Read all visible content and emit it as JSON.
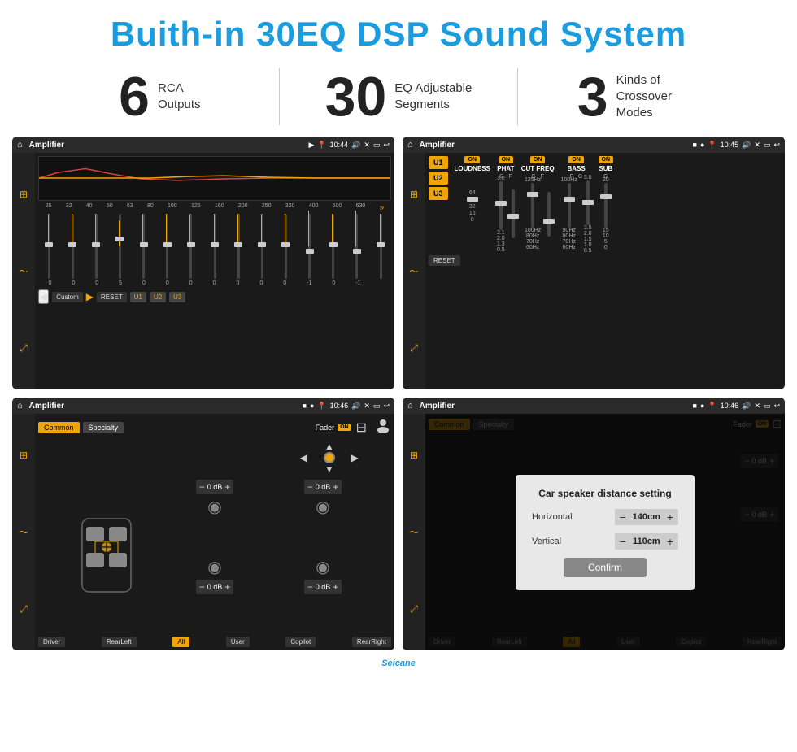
{
  "header": {
    "title": "Buith-in 30EQ DSP Sound System"
  },
  "stats": [
    {
      "number": "6",
      "desc": "RCA\nOutputs"
    },
    {
      "number": "30",
      "desc": "EQ Adjustable\nSegments"
    },
    {
      "number": "3",
      "desc": "Kinds of\nCrossover Modes"
    }
  ],
  "screens": {
    "eq": {
      "app_title": "Amplifier",
      "time": "10:44",
      "freq_labels": [
        "25",
        "32",
        "40",
        "50",
        "63",
        "80",
        "100",
        "125",
        "160",
        "200",
        "250",
        "320",
        "400",
        "500",
        "630"
      ],
      "values": [
        "0",
        "0",
        "0",
        "5",
        "0",
        "0",
        "0",
        "0",
        "0",
        "0",
        "0",
        "-1",
        "0",
        "-1"
      ],
      "controls": [
        "Custom",
        "RESET",
        "U1",
        "U2",
        "U3"
      ]
    },
    "amp": {
      "app_title": "Amplifier",
      "time": "10:45",
      "u_buttons": [
        "U1",
        "U2",
        "U3"
      ],
      "controls": [
        {
          "on": true,
          "label": "LOUDNESS",
          "sublabel": ""
        },
        {
          "on": true,
          "label": "PHAT",
          "sublabel": "G F"
        },
        {
          "on": true,
          "label": "CUT FREQ",
          "sublabel": "G F"
        },
        {
          "on": true,
          "label": "BASS",
          "sublabel": "F G"
        },
        {
          "on": true,
          "label": "SUB",
          "sublabel": "G"
        }
      ],
      "reset": "RESET"
    },
    "common": {
      "app_title": "Amplifier",
      "time": "10:46",
      "tabs": [
        "Common",
        "Specialty"
      ],
      "fader": "Fader",
      "fader_on": "ON",
      "speakers": {
        "tl_db": "0 dB",
        "tr_db": "0 dB",
        "bl_db": "0 dB",
        "br_db": "0 dB"
      },
      "buttons": [
        "Driver",
        "RearLeft",
        "All",
        "User",
        "Copilot",
        "RearRight"
      ]
    },
    "dialog": {
      "app_title": "Amplifier",
      "time": "10:46",
      "modal": {
        "title": "Car speaker distance setting",
        "horizontal_label": "Horizontal",
        "horizontal_value": "140cm",
        "vertical_label": "Vertical",
        "vertical_value": "110cm",
        "confirm": "Confirm"
      },
      "speakers": {
        "tr_db": "0 dB",
        "br_db": "0 dB"
      },
      "buttons": [
        "Driver",
        "RearLeft",
        "All",
        "User",
        "Copilot",
        "RearRight"
      ]
    }
  },
  "watermark": "Seicane"
}
